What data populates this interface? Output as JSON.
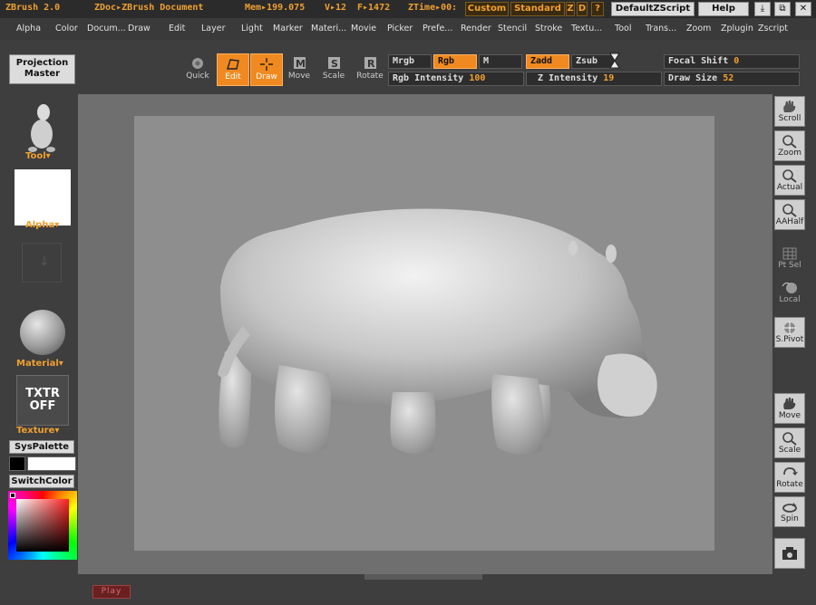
{
  "titlebar": {
    "app": "ZBrush 2.0",
    "doc": "ZDoc▸ZBrush Document",
    "mem": "Mem▸199.075",
    "v": "V▸12",
    "f": "F▸1472",
    "ztime": "ZTime▸00:",
    "custom": "Custom",
    "standard": "Standard",
    "z": "Z",
    "d": "D",
    "q": "?",
    "defaultzscript": "DefaultZScript",
    "help": "Help"
  },
  "menu": [
    "Alpha",
    "Color",
    "Docum...",
    "Draw",
    "Edit",
    "Layer",
    "Light",
    "Marker",
    "Materi...",
    "Movie",
    "Picker",
    "Prefe...",
    "Render",
    "Stencil",
    "Stroke",
    "Textu...",
    "Tool",
    "Trans...",
    "Zoom",
    "Zplugin",
    "Zscript"
  ],
  "toolbar": {
    "projection_master": "Projection Master",
    "quick": "Quick",
    "edit": "Edit",
    "draw": "Draw",
    "move": "Move",
    "scale": "Scale",
    "rotate": "Rotate",
    "mrgb": "Mrgb",
    "rgb": "Rgb",
    "m": "M",
    "zadd": "Zadd",
    "zsub": "Zsub",
    "rgb_intensity_label": "Rgb Intensity",
    "rgb_intensity_value": "100",
    "z_intensity_label": "Z Intensity",
    "z_intensity_value": "19",
    "focal_shift_label": "Focal Shift",
    "focal_shift_value": "0",
    "draw_size_label": "Draw Size",
    "draw_size_value": "52"
  },
  "leftshelf": {
    "tool": "Tool",
    "alpha": "Alpha",
    "material": "Material",
    "texture_off": "TXTR OFF",
    "texture": "Texture",
    "syspalette": "SysPalette",
    "switchcolor": "SwitchColor"
  },
  "rightshelf": {
    "scroll": "Scroll",
    "zoom": "Zoom",
    "actual": "Actual",
    "aahalf": "AAHalf",
    "ptsel": "Pt Sel",
    "local": "Local",
    "spivot": "S.Pivot",
    "move": "Move",
    "scale": "Scale",
    "rotate": "Rotate",
    "spin": "Spin"
  },
  "bottom": {
    "play": "Play"
  },
  "colors": {
    "accent": "#f08a20",
    "panel": "#3e3e3e",
    "canvas": "#8e8e8e",
    "doc_bg": "#6f6f6f"
  }
}
